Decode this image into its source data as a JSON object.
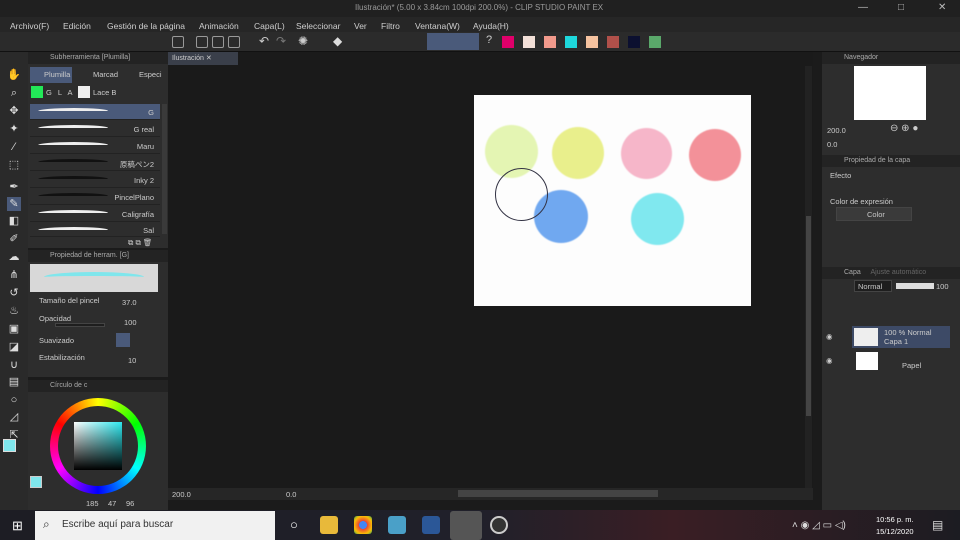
{
  "window": {
    "title": "Ilustración* (5.00 x 3.84cm 100dpi 200.0%)  - CLIP STUDIO PAINT EX"
  },
  "menu": [
    "Archivo(F)",
    "Edición",
    "Gestión de la página",
    "Animación",
    "Capa(L)",
    "Seleccionar",
    "Ver",
    "Filtro",
    "Ventana(W)",
    "Ayuda(H)"
  ],
  "palette_colors": [
    "#e0006a",
    "#f3e0d8",
    "#f29a8c",
    "#1ed8dc",
    "#f6c3a0",
    "#b0504a",
    "#0c1030",
    "#5aa86a"
  ],
  "subtool": {
    "title": "Subherramienta [Plumilla]",
    "tabs": [
      "Plumilla",
      "Marcad",
      "Especi"
    ],
    "sets": [
      "G L A S",
      "Lace B"
    ],
    "brushes": [
      "G",
      "G real",
      "Maru",
      "原稿ペン2",
      "Inky 2",
      "PincelPlano",
      "Caligrafía",
      "Sal"
    ]
  },
  "toolprop": {
    "title": "Propiedad de herram. [G]",
    "size_label": "Tamaño del pincel",
    "size_value": "37.0",
    "opacity_label": "Opacidad",
    "opacity_value": "100",
    "smoothing_label": "Suavizado",
    "stabilization_label": "Estabilización",
    "stabilization_value": "10"
  },
  "color": {
    "title": "Círculo de c",
    "h": "185",
    "s": "47",
    "v": "96",
    "fg": "#7fe6ec"
  },
  "canvas": {
    "tab": "Ilustración",
    "dots": [
      {
        "c": "#e4f5b3"
      },
      {
        "c": "#e9ef8c"
      },
      {
        "c": "#f6b6c9"
      },
      {
        "c": "#f39199"
      },
      {
        "c": "#70a8f0"
      },
      {
        "c": "#80e8ef"
      }
    ]
  },
  "status": {
    "zoom": "200.0",
    "angle": "0.0"
  },
  "navigator": {
    "title": "Navegador",
    "zoom": "200.0",
    "angle": "0.0"
  },
  "layerprop": {
    "title": "Propiedad de la capa",
    "effect": "Efecto",
    "expr_label": "Color de expresión",
    "expr_value": "Color"
  },
  "layers": {
    "title": "Capa",
    "tab2": "Ajuste automático",
    "blend": "Normal",
    "opacity": "100",
    "items": [
      {
        "line1": "100 % Normal",
        "line2": "Capa 1"
      },
      {
        "line1": "",
        "line2": "Papel"
      }
    ]
  },
  "taskbar": {
    "search_placeholder": "Escribe aquí para buscar",
    "time": "10:56 p. m.",
    "date": "15/12/2020"
  }
}
